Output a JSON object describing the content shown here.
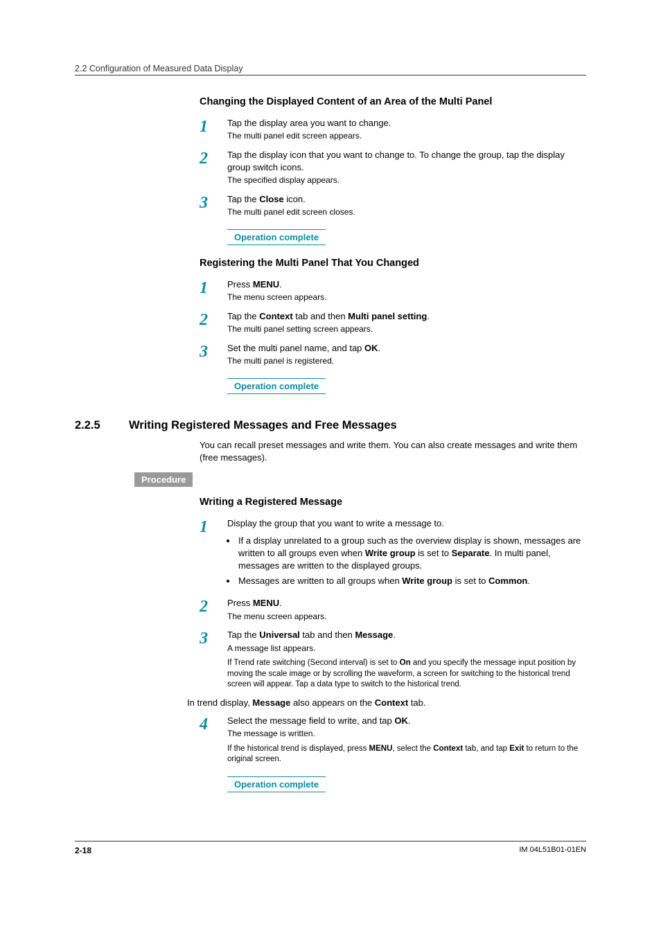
{
  "header": "2.2  Configuration of Measured Data Display",
  "footer": {
    "page": "2-18",
    "doc": "IM 04L51B01-01EN"
  },
  "sec1": {
    "heading": "Changing the Displayed Content of an Area of the Multi Panel",
    "steps": [
      {
        "n": "1",
        "main": "Tap the display area you want to change.",
        "sub": "The multi panel edit screen appears."
      },
      {
        "n": "2",
        "main_parts": [
          "Tap the display icon that you want to change to. To change the group, tap the display group switch icons."
        ],
        "sub": "The specified display appears."
      },
      {
        "n": "3",
        "main_parts": [
          "Tap the ",
          "Close",
          " icon."
        ],
        "sub": "The multi panel edit screen closes."
      }
    ],
    "complete": "Operation complete"
  },
  "sec2": {
    "heading": "Registering the Multi Panel That You Changed",
    "steps": [
      {
        "n": "1",
        "main_parts": [
          "Press ",
          "MENU",
          "."
        ],
        "sub": "The menu screen appears."
      },
      {
        "n": "2",
        "main_parts": [
          "Tap the ",
          "Context",
          " tab and then ",
          "Multi panel setting",
          "."
        ],
        "sub": "The multi panel setting screen appears."
      },
      {
        "n": "3",
        "main_parts": [
          "Set the multi panel name, and tap ",
          "OK",
          "."
        ],
        "sub": "The multi panel is registered."
      }
    ],
    "complete": "Operation complete"
  },
  "sec3": {
    "num": "2.2.5",
    "title": "Writing Registered Messages and Free Messages",
    "intro": "You can recall preset messages and write them. You can also create messages and write them (free messages).",
    "procedure_label": "Procedure",
    "heading": "Writing a Registered Message",
    "step1": {
      "n": "1",
      "main": "Display the group that you want to write a message to.",
      "bullets": [
        [
          "If a display unrelated to a group such as the overview display is shown, messages are written to all groups even when ",
          "Write group",
          " is set to ",
          "Separate",
          ". In multi panel, messages are written to the displayed groups."
        ],
        [
          "Messages are written to all groups when ",
          "Write group",
          " is set to ",
          "Common",
          "."
        ]
      ]
    },
    "step2": {
      "n": "2",
      "main_parts": [
        "Press ",
        "MENU",
        "."
      ],
      "sub": "The menu screen appears."
    },
    "step3": {
      "n": "3",
      "main_parts": [
        "Tap the ",
        "Universal",
        " tab and then ",
        "Message",
        "."
      ],
      "sub": "A message list appears.",
      "note_parts": [
        "If Trend rate switching (Second interval) is set to ",
        "On",
        " and you specify the message input position by moving the scale image or by scrolling the waveform, a screen for switching to the historical trend screen will appear. Tap a data type to switch to the historical trend."
      ]
    },
    "context_note": [
      "In trend display, ",
      "Message",
      " also appears on the ",
      "Context",
      " tab."
    ],
    "step4": {
      "n": "4",
      "main_parts": [
        "Select the message field to write, and tap ",
        "OK",
        "."
      ],
      "sub": "The message is written.",
      "note_parts": [
        "If the historical trend is displayed, press ",
        "MENU",
        ", select the ",
        "Context",
        " tab, and tap ",
        "Exit",
        " to return to the original screen."
      ]
    },
    "complete": "Operation complete"
  }
}
